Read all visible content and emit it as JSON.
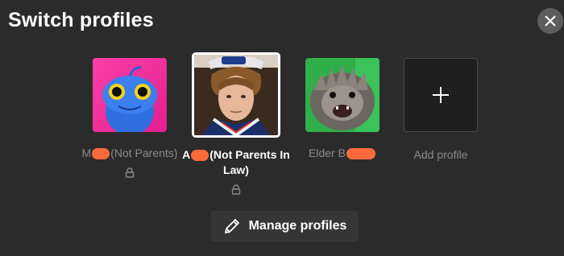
{
  "header": {
    "title": "Switch profiles"
  },
  "icons": {
    "close": "close-icon",
    "lock": "lock-icon",
    "plus": "plus-icon",
    "pencil": "pencil-icon"
  },
  "colors": {
    "background": "#2b2b2b",
    "redaction": "#ff6a3d",
    "selected_border": "#ffffff",
    "muted_text": "#8c8c8c"
  },
  "profiles": [
    {
      "name_start": "M",
      "name_end": "(Not Parents)",
      "locked": true,
      "selected": false
    },
    {
      "name_start": "A",
      "name_end": "(Not Parents In Law)",
      "locked": true,
      "selected": true
    },
    {
      "name_start": "Elder B",
      "name_end": "",
      "locked": false,
      "selected": false
    }
  ],
  "add_profile": {
    "label": "Add profile"
  },
  "footer": {
    "manage_label": "Manage profiles"
  }
}
